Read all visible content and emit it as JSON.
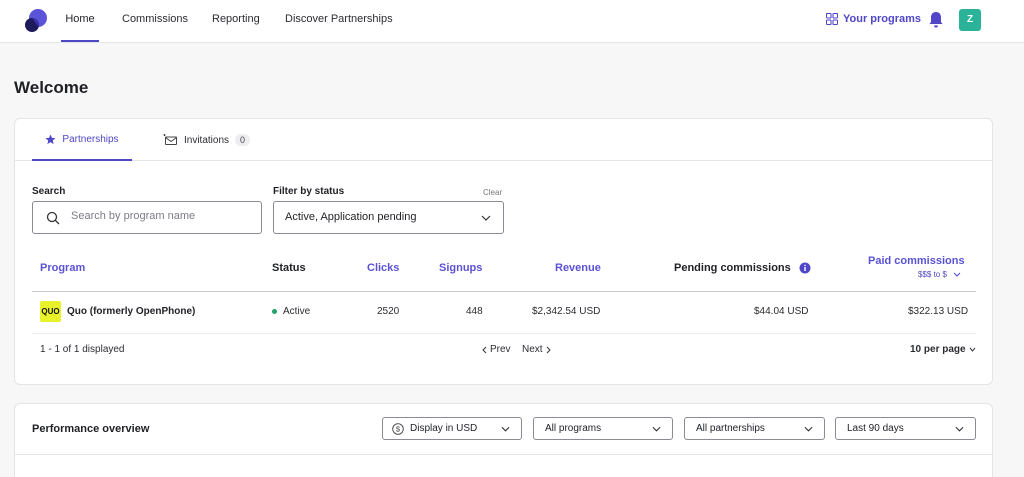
{
  "nav": {
    "items": [
      "Home",
      "Commissions",
      "Reporting",
      "Discover Partnerships"
    ],
    "your_programs": "Your programs",
    "avatar_initial": "Z",
    "icons": [
      "app-logo-icon",
      "grid-icon",
      "bell-icon"
    ]
  },
  "page": {
    "title": "Welcome"
  },
  "tabs": {
    "partnerships": "Partnerships",
    "invitations": "Invitations",
    "invitations_count": "0"
  },
  "filters": {
    "search_label": "Search",
    "search_placeholder": "Search by program name",
    "status_label": "Filter by status",
    "clear": "Clear",
    "status_value": "Active, Application pending"
  },
  "table": {
    "headers": {
      "program": "Program",
      "status": "Status",
      "clicks": "Clicks",
      "signups": "Signups",
      "revenue": "Revenue",
      "pending": "Pending commissions",
      "paid": "Paid commissions",
      "paid_sort": "$$$ to $"
    },
    "rows": [
      {
        "logo_text": "QUO",
        "program": "Quo (formerly OpenPhone)",
        "status": "Active",
        "clicks": "2520",
        "signups": "448",
        "revenue": "$2,342.54 USD",
        "pending": "$44.04 USD",
        "paid": "$322.13 USD"
      }
    ],
    "pagination": {
      "summary": "1 - 1 of 1 displayed",
      "prev": "Prev",
      "next": "Next",
      "per_page": "10 per page"
    }
  },
  "performance": {
    "title": "Performance overview",
    "currency": "Display in USD",
    "programs": "All programs",
    "partnerships": "All partnerships",
    "range": "Last 90 days"
  },
  "colors": {
    "accent": "#4f46c8",
    "status_active": "#22a06b",
    "avatar": "#2bb39a",
    "quo_logo": "#e8f22a"
  }
}
